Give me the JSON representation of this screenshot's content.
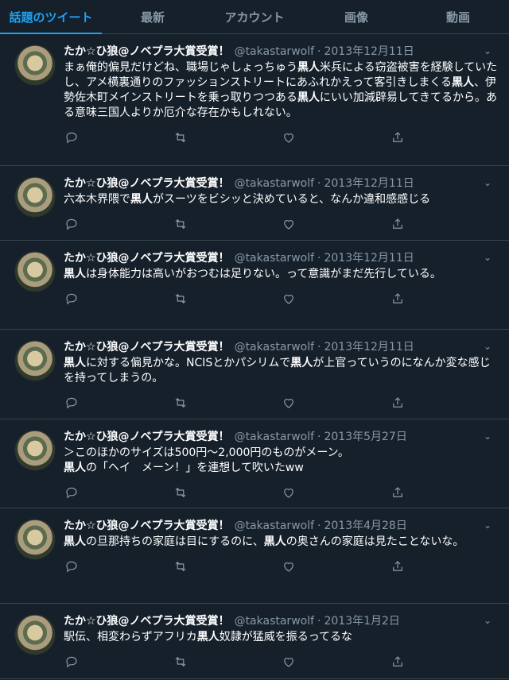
{
  "tabs": [
    {
      "label": "話題のツイート",
      "active": true
    },
    {
      "label": "最新",
      "active": false
    },
    {
      "label": "アカウント",
      "active": false
    },
    {
      "label": "画像",
      "active": false
    },
    {
      "label": "動画",
      "active": false
    }
  ],
  "tweets": [
    {
      "name": "たか☆ひ狼@ノベプラ大賞受賞！",
      "handle": "@takastarwolf",
      "sep": "·",
      "date": "2013年12月11日",
      "text": [
        {
          "t": "まぁ俺的偏見だけどね、職場じゃしょっちゅう"
        },
        {
          "t": "黒人",
          "b": true
        },
        {
          "t": "米兵による窃盗被害を経験していたし、アメ横裏通りのファッションストリートにあふれかえって客引きしまくる"
        },
        {
          "t": "黒人",
          "b": true
        },
        {
          "t": "、伊勢佐木町メインストリートを乗っ取りつつある"
        },
        {
          "t": "黒人",
          "b": true
        },
        {
          "t": "にいい加減辟易してきてるから。ある意味三国人よりか厄介な存在かもしれない。"
        }
      ]
    },
    {
      "name": "たか☆ひ狼@ノベプラ大賞受賞！",
      "handle": "@takastarwolf",
      "sep": "·",
      "date": "2013年12月11日",
      "text": [
        {
          "t": "六本木界隈で"
        },
        {
          "t": "黒人",
          "b": true
        },
        {
          "t": "がスーツをビシッと決めていると、なんか違和感感じる"
        }
      ]
    },
    {
      "name": "たか☆ひ狼@ノベプラ大賞受賞！",
      "handle": "@takastarwolf",
      "sep": "·",
      "date": "2013年12月11日",
      "text": [
        {
          "t": "黒人",
          "b": true
        },
        {
          "t": "は身体能力は高いがおつむは足りない。って意識がまだ先行している。"
        }
      ]
    },
    {
      "name": "たか☆ひ狼@ノベプラ大賞受賞！",
      "handle": "@takastarwolf",
      "sep": "·",
      "date": "2013年12月11日",
      "text": [
        {
          "t": "黒人",
          "b": true
        },
        {
          "t": "に対する偏見かな。NCISとかパシリムで"
        },
        {
          "t": "黒人",
          "b": true
        },
        {
          "t": "が上官っていうのになんか変な感じを持ってしまうの。"
        }
      ]
    },
    {
      "name": "たか☆ひ狼@ノベプラ大賞受賞！",
      "handle": "@takastarwolf",
      "sep": "·",
      "date": "2013年5月27日",
      "text": [
        {
          "t": "＞このほかのサイズは500円～2,000円のものがメーン。\n"
        },
        {
          "t": "黒人",
          "b": true
        },
        {
          "t": "の「ヘイ　メーン！」を連想して吹いたww"
        }
      ]
    },
    {
      "name": "たか☆ひ狼@ノベプラ大賞受賞！",
      "handle": "@takastarwolf",
      "sep": "·",
      "date": "2013年4月28日",
      "text": [
        {
          "t": "黒人",
          "b": true
        },
        {
          "t": "の旦那持ちの家庭は目にするのに、"
        },
        {
          "t": "黒人",
          "b": true
        },
        {
          "t": "の奥さんの家庭は見たことないな。"
        }
      ]
    },
    {
      "name": "たか☆ひ狼@ノベプラ大賞受賞！",
      "handle": "@takastarwolf",
      "sep": "·",
      "date": "2013年1月2日",
      "text": [
        {
          "t": "駅伝、相変わらずアフリカ"
        },
        {
          "t": "黒人",
          "b": true
        },
        {
          "t": "奴隷が猛威を振るってるな"
        }
      ]
    }
  ],
  "icons": {
    "reply": "reply-icon",
    "retweet": "retweet-icon",
    "like": "like-icon",
    "share": "share-icon",
    "more": "chevron-down-icon"
  }
}
